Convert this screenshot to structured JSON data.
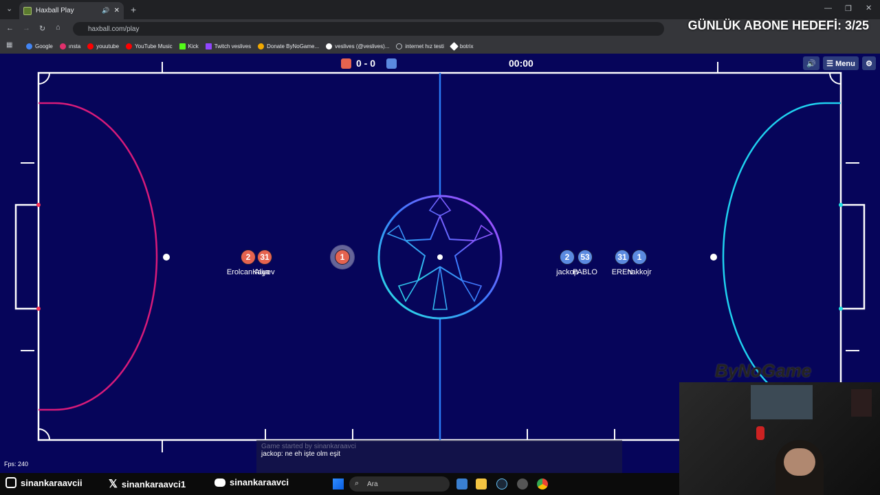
{
  "browser": {
    "tab_title": "Haxball Play",
    "url": "haxball.com/play",
    "bookmarks": [
      {
        "label": "Google",
        "color": "#4285f4"
      },
      {
        "label": "ınsta",
        "color": "#e1306c"
      },
      {
        "label": "youutube",
        "color": "#ff0000"
      },
      {
        "label": "YouTube Music",
        "color": "#ff0000"
      },
      {
        "label": "Kick",
        "color": "#53fc18"
      },
      {
        "label": "Twitch veslives",
        "color": "#9146ff"
      },
      {
        "label": "Donate ByNoGame...",
        "color": "#f2a900"
      },
      {
        "label": "veslives (@veslives)...",
        "color": "#ffffff"
      },
      {
        "label": "internet hız testi",
        "color": "#bdc1c6"
      },
      {
        "label": "botrix",
        "color": "#ffffff"
      }
    ]
  },
  "overlay": {
    "goal_text": "GÜNLÜK ABONE HEDEFİ: 3/25",
    "brand": "ByNoGame"
  },
  "game": {
    "score": "0 - 0",
    "timer": "00:00",
    "menu_label": "☰ Menu",
    "fps": "Fps: 240",
    "red_color": "#e5634f",
    "blue_color": "#5b8ae0",
    "red_players": [
      {
        "number": "2",
        "name": "ErolcanKaya"
      },
      {
        "number": "31",
        "name": "Aliyev"
      },
      {
        "number": "1",
        "name": ""
      }
    ],
    "blue_players": [
      {
        "number": "2",
        "name": "jackop"
      },
      {
        "number": "53",
        "name": "PABLO"
      },
      {
        "number": "31",
        "name": "EREN"
      },
      {
        "number": "1",
        "name": "nakkojr"
      }
    ]
  },
  "chat": {
    "old_message": "Game started by sinankaraavci",
    "last_message": "jackop: ne eh işte olm eşit"
  },
  "social": {
    "instagram": "sinankaraavcii",
    "x": "sinankaraavci1",
    "youtube": "sinankaraavci"
  },
  "taskbar": {
    "search_placeholder": "Ara"
  }
}
